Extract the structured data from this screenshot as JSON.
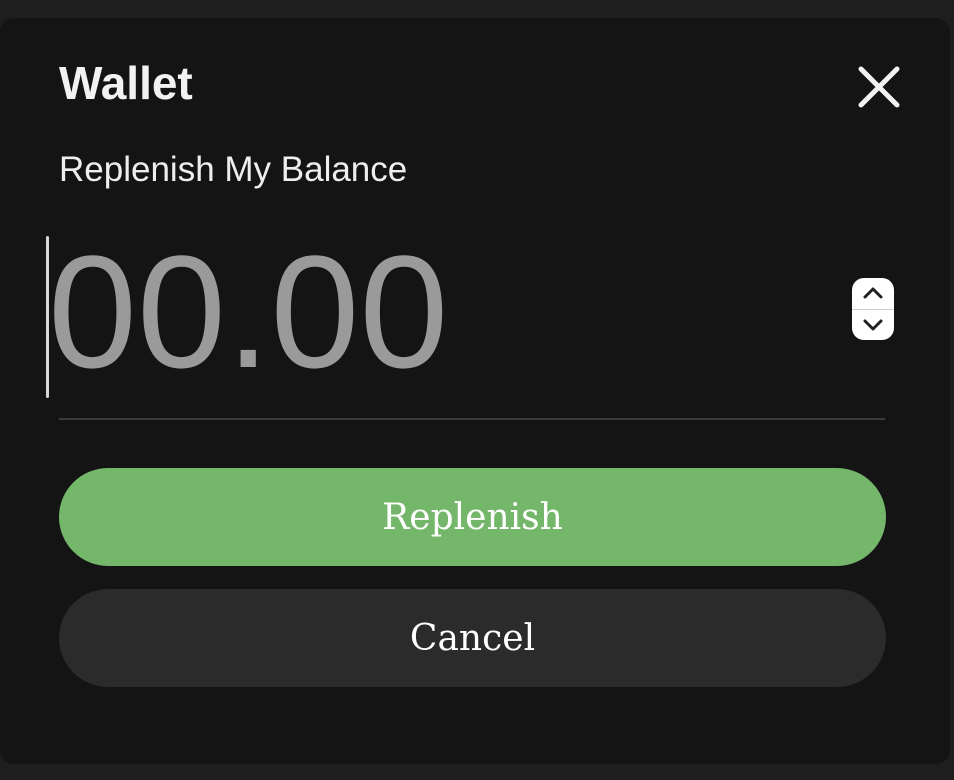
{
  "dialog": {
    "title": "Wallet",
    "subtitle": "Replenish My Balance",
    "close_icon": "close-icon"
  },
  "amount": {
    "placeholder": "00.00",
    "value": "",
    "stepper_up_icon": "chevron-up-icon",
    "stepper_down_icon": "chevron-down-icon"
  },
  "actions": {
    "primary_label": "Replenish",
    "secondary_label": "Cancel"
  },
  "colors": {
    "background": "#141414",
    "primary": "#74b76a",
    "secondary": "#2b2b2b",
    "text": "#f2f2f2",
    "placeholder": "#9a9a9a"
  }
}
